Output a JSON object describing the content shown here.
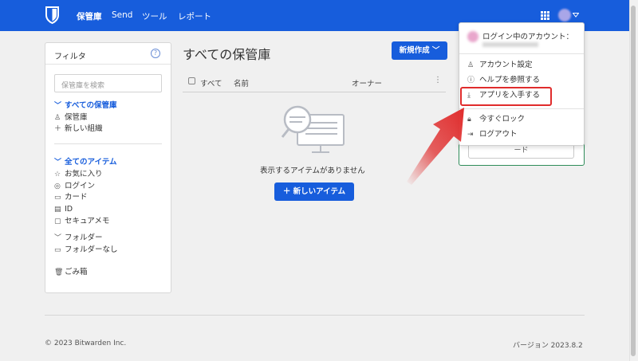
{
  "nav": {
    "links": [
      "保管庫",
      "Send",
      "ツール",
      "レポート"
    ]
  },
  "filter": {
    "title": "フィルタ",
    "info_icon": "?",
    "search_placeholder": "保管庫を検索",
    "vaults_header": "すべての保管庫",
    "vault_items": [
      "保管庫",
      "新しい組織"
    ],
    "items_header": "全てのアイテム",
    "types": [
      "お気に入り",
      "ログイン",
      "カード",
      "ID",
      "セキュアメモ"
    ],
    "folders_header": "フォルダー",
    "no_folder": "フォルダーなし",
    "trash": "ごみ箱"
  },
  "main": {
    "title": "すべての保管庫",
    "new_button": "新規作成",
    "col_all": "すべて",
    "col_name": "名前",
    "col_owner": "オーナー",
    "empty_text": "表示するアイテムがありません",
    "new_item_button": "新しいアイテム"
  },
  "org_card": {
    "button_text": "ード"
  },
  "dropdown": {
    "account_label": "ログイン中のアカウント：",
    "items": [
      "アカウント設定",
      "ヘルプを参照する",
      "アプリを入手する",
      "今すぐロック",
      "ログアウト"
    ]
  },
  "footer": {
    "copyright": "© 2023 Bitwarden Inc.",
    "version": "バージョン 2023.8.2"
  },
  "colors": {
    "brand": "#175ddc",
    "highlight": "#e02c2c"
  },
  "icons": [
    "shield-logo-icon",
    "app-grid-icon",
    "chevron-down-icon",
    "user-icon",
    "help-circle-icon",
    "download-icon",
    "lock-icon",
    "sign-out-icon",
    "star-icon",
    "globe-icon",
    "credit-card-icon",
    "id-card-icon",
    "sticky-note-icon",
    "folder-icon",
    "trash-icon",
    "plus-icon"
  ]
}
